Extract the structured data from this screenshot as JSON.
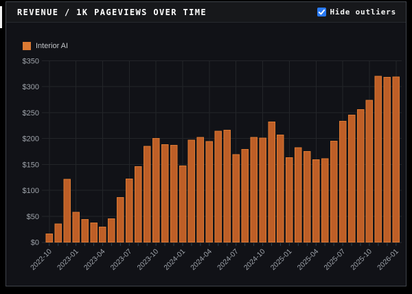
{
  "header": {
    "title": "REVENUE / 1K PAGEVIEWS OVER TIME",
    "checkbox_label": "Hide outliers",
    "checkbox_checked": true
  },
  "legend": {
    "label": "Interior AI"
  },
  "colors": {
    "bar_fill": "#BE5F27",
    "bar_border": "#DC7A33",
    "checkbox_blue": "#2979F2",
    "checkbox_check": "#FFFFFF",
    "axis_text": "#9FA4AB",
    "grid_line": "#232529",
    "axis_line": "#2B2F36",
    "minor_tick": "#2C4350",
    "panel_bg": "#111217",
    "header_bg": "#17181B",
    "title_text": "#FFFFFF"
  },
  "chart_data": {
    "type": "bar",
    "title": "REVENUE / 1K PAGEVIEWS OVER TIME",
    "xlabel": "",
    "ylabel": "",
    "ylim": [
      0,
      350
    ],
    "y_ticks": [
      0,
      50,
      100,
      150,
      200,
      250,
      300,
      350
    ],
    "y_tick_prefix": "$",
    "grid": true,
    "legend_position": "top-left",
    "categories": [
      "2022-10",
      "2022-11",
      "2022-12",
      "2023-01",
      "2023-02",
      "2023-03",
      "2023-04",
      "2023-05",
      "2023-06",
      "2023-07",
      "2023-08",
      "2023-09",
      "2023-10",
      "2023-11",
      "2023-12",
      "2024-01",
      "2024-02",
      "2024-03",
      "2024-04",
      "2024-05",
      "2024-06",
      "2024-07",
      "2024-08",
      "2024-09",
      "2024-10",
      "2024-11",
      "2024-12",
      "2025-01",
      "2025-02",
      "2025-03",
      "2025-04",
      "2025-05",
      "2025-06",
      "2025-07",
      "2025-08",
      "2025-09",
      "2025-10",
      "2025-11",
      "2025-12",
      "2026-01"
    ],
    "x_tick_labels": [
      "2022-10",
      "2023-01",
      "2023-04",
      "2023-07",
      "2023-10",
      "2024-01",
      "2024-04",
      "2024-07",
      "2024-10",
      "2025-01",
      "2025-04",
      "2025-07",
      "2025-10",
      "2026-01"
    ],
    "series": [
      {
        "name": "Interior AI",
        "values": [
          16,
          35,
          121,
          58,
          44,
          37,
          29,
          45,
          86,
          122,
          146,
          185,
          200,
          188,
          187,
          147,
          197,
          202,
          194,
          214,
          216,
          169,
          179,
          202,
          201,
          232,
          207,
          163,
          182,
          175,
          159,
          161,
          195,
          233,
          245,
          256,
          274,
          320,
          318,
          319
        ]
      }
    ]
  }
}
